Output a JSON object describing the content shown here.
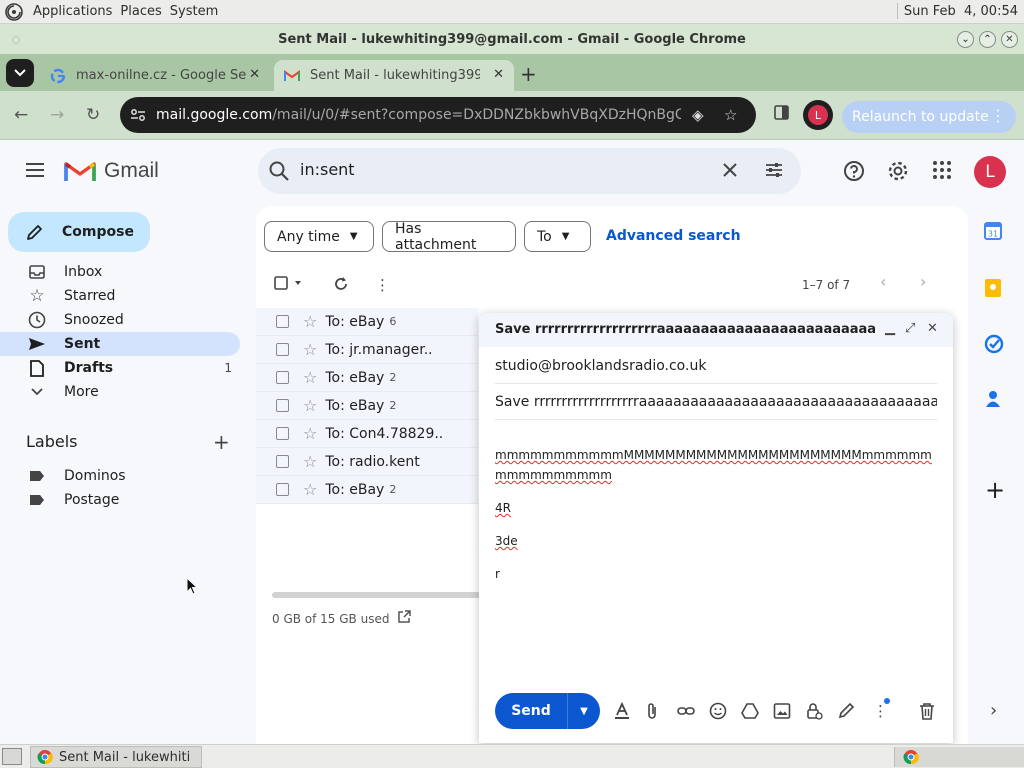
{
  "system_panel": {
    "menus": [
      "Applications",
      "Places",
      "System"
    ],
    "clock": "Sun Feb  4, 00:54"
  },
  "window": {
    "title": "Sent Mail - lukewhiting399@gmail.com - Gmail - Google Chrome"
  },
  "tabs": [
    {
      "label": "max-onilne.cz - Google Sea",
      "favicon": "google-icon",
      "active": false
    },
    {
      "label": "Sent Mail - lukewhiting399@",
      "favicon": "gmail-icon",
      "active": true
    }
  ],
  "omnibox": {
    "url_host": "mail.google.com",
    "url_rest": "/mail/u/0/#sent?compose=DxDDNZbkbwhVBqXDzHQnBgCmxLF..."
  },
  "toolbar": {
    "profile_initial": "L",
    "relaunch_label": "Relaunch to update"
  },
  "gmail": {
    "brand": "Gmail",
    "search_value": "in:sent",
    "avatar_initial": "L",
    "compose_label": "Compose",
    "nav": [
      {
        "label": "Inbox",
        "icon": "inbox-icon",
        "count": ""
      },
      {
        "label": "Starred",
        "icon": "star-icon",
        "count": ""
      },
      {
        "label": "Snoozed",
        "icon": "clock-icon",
        "count": ""
      },
      {
        "label": "Sent",
        "icon": "send-icon",
        "count": ""
      },
      {
        "label": "Drafts",
        "icon": "draft-icon",
        "count": "1"
      },
      {
        "label": "More",
        "icon": "chevron-down-icon",
        "count": ""
      }
    ],
    "labels_title": "Labels",
    "labels": [
      "Dominos",
      "Postage"
    ],
    "filters": {
      "any_time": "Any time",
      "has_attachment": "Has attachment",
      "to": "To",
      "advanced": "Advanced search"
    },
    "range": "1–7 of 7",
    "rows": [
      {
        "to": "To: eBay",
        "count": "6"
      },
      {
        "to": "To: jr.manager..",
        "count": ""
      },
      {
        "to": "To: eBay",
        "count": "2"
      },
      {
        "to": "To: eBay",
        "count": "2"
      },
      {
        "to": "To: Con4.78829..",
        "count": ""
      },
      {
        "to": "To: radio.kent",
        "count": ""
      },
      {
        "to": "To: eBay",
        "count": "2"
      }
    ],
    "storage": "0 GB of 15 GB used"
  },
  "compose": {
    "title": "Save rrrrrrrrrrrrrrrrrrraaaaaaaaaaaaaaaaaaaaaaaaaaaaaa...",
    "to": "studio@brooklandsradio.co.uk",
    "subject": "Save rrrrrrrrrrrrrrrrrrraaaaaaaaaaaaaaaaaaaaaaaaaaaaaaaaaaaaaaaaaaaaaaaa",
    "body_line1": "mmmmmmmmmmmMMMMMMMMMMMMMMMMMMMMMMMmmmmmmmmmmmmmmmm",
    "body_line2": "4R",
    "body_line3": "3de",
    "body_line4": "r",
    "send_label": "Send"
  },
  "taskbar": {
    "item_label": "Sent Mail - lukewhiti..."
  },
  "colors": {
    "chrome_frame": "#a9c6a4",
    "chrome_toolbar": "#cfe0cc",
    "gmail_bg": "#f6f8fc",
    "compose_accent": "#c2e7ff",
    "active_nav": "#d3e3fd",
    "send_blue": "#0b57d0",
    "avatar_red": "#d9324f"
  }
}
